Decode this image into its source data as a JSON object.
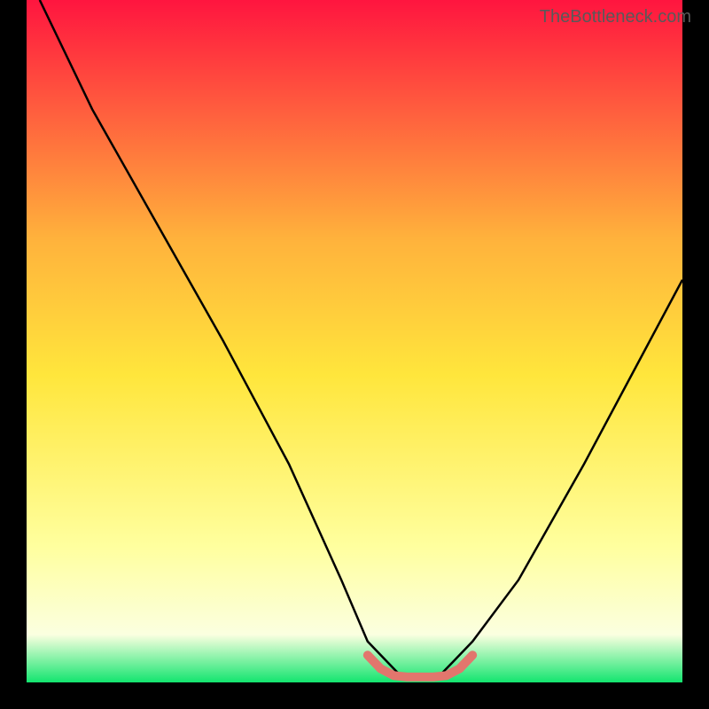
{
  "watermark": "TheBottleneck.com",
  "colors": {
    "top": "#ff153f",
    "q1": "#ffb23c",
    "mid": "#ffe63c",
    "q3": "#ffff9e",
    "near_bottom": "#fbffe0",
    "bottom": "#13e56f",
    "curve": "#000000",
    "marker": "#e2766d",
    "frame": "#000000"
  },
  "chart_data": {
    "type": "line",
    "title": "",
    "xlabel": "",
    "ylabel": "",
    "xlim": [
      0,
      100
    ],
    "ylim": [
      0,
      100
    ],
    "series": [
      {
        "name": "bottleneck-curve",
        "x": [
          2,
          10,
          20,
          30,
          40,
          48,
          52,
          57,
          60,
          63,
          68,
          75,
          85,
          95,
          100
        ],
        "y": [
          100,
          84,
          67,
          50,
          32,
          15,
          6,
          1,
          0.5,
          1,
          6,
          15,
          32,
          50,
          59
        ]
      },
      {
        "name": "optimal-zone-marker",
        "x": [
          52,
          54,
          56,
          58,
          60,
          62,
          64,
          66,
          68
        ],
        "y": [
          4,
          2,
          1,
          0.8,
          0.8,
          0.8,
          1,
          2,
          4
        ]
      }
    ]
  }
}
